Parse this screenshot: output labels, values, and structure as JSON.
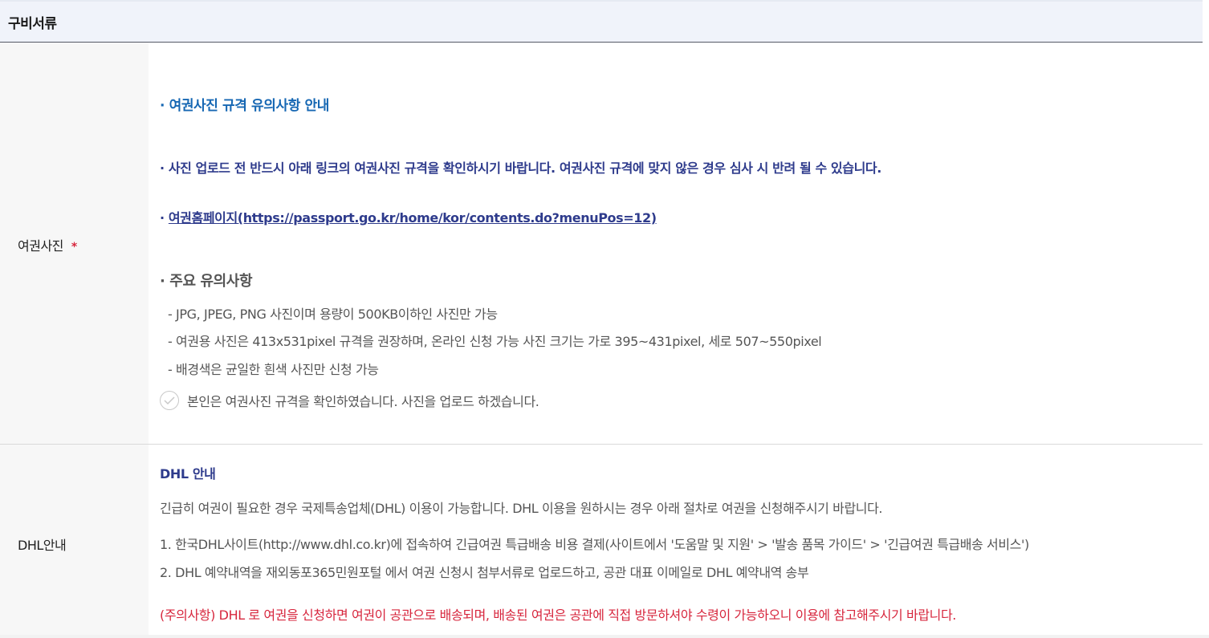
{
  "section": {
    "title": "구비서류"
  },
  "photo": {
    "label": "여권사진",
    "required_mark": "*",
    "line1": "·  여권사진 규격 유의사항 안내",
    "line2": "·  사진 업로드 전 반드시 아래 링크의 여권사진 규격을 확인하시기 바랍니다. 여권사진 규격에 맞지 않은 경우 심사 시 반려 될 수 있습니다.",
    "link_prefix": "·  ",
    "link_text": "여권홈페이지(https://passport.go.kr/home/kor/contents.do?menuPos=12)",
    "notice_title": "·  주요 유의사항",
    "details": [
      "- JPG, JPEG, PNG 사진이며 용량이 500KB이하인 사진만 가능",
      "- 여권용 사진은 413x531pixel 규격을 권장하며, 온라인 신청 가능 사진 크기는 가로 395~431pixel, 세로 507~550pixel",
      "- 배경색은 균일한 흰색 사진만 신청 가능"
    ],
    "confirm_label": "본인은 여권사진 규격을 확인하였습니다. 사진을 업로드 하겠습니다.",
    "confirm_icon": "check-circle-icon"
  },
  "dhl": {
    "label": "DHL안내",
    "title": "DHL 안내",
    "intro": "긴급히 여권이 필요한 경우 국제특송업체(DHL) 이용이 가능합니다. DHL 이용을 원하시는 경우 아래 절차로 여권을 신청해주시기 바랍니다.",
    "steps": [
      "1. 한국DHL사이트(http://www.dhl.co.kr)에 접속하여 긴급여권 특급배송 비용 결제(사이트에서 '도움말 및 지원' > '발송 품목 가이드' > '긴급여권 특급배송 서비스')",
      "2. DHL 예약내역을 재외동포365민원포털 에서 여권 신청시 첨부서류로 업로드하고, 공관 대표 이메일로 DHL 예약내역 송부"
    ],
    "warning": "(주의사항) DHL 로 여권을 신청하면 여권이 공관으로 배송되며, 배송된 여권은 공관에 직접 방문하셔야 수령이 가능하오니 이용에 참고해주시기 바랍니다."
  },
  "colors": {
    "blue": "#1667b3",
    "navy": "#2e3b8c",
    "red": "#d7263d"
  }
}
